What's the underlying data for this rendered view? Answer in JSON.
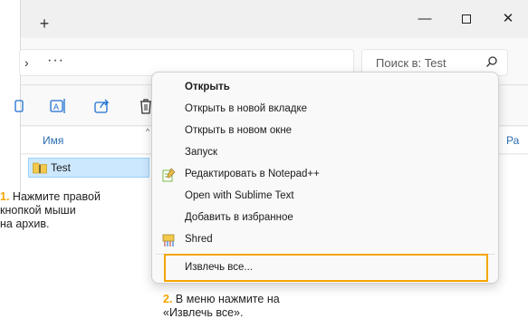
{
  "window": {
    "new_tab": "+",
    "minimize": "—",
    "close": "✕"
  },
  "nav": {
    "chevron": "›",
    "overflow": "···",
    "search_placeholder": "Поиск в: Test"
  },
  "list": {
    "col_name": "Имя",
    "col_right": "Ра",
    "file_name": "Test"
  },
  "menu": {
    "items": [
      {
        "label": "Открыть",
        "icon": ""
      },
      {
        "label": "Открыть в новой вкладке",
        "icon": ""
      },
      {
        "label": "Открыть в новом окне",
        "icon": ""
      },
      {
        "label": "Запуск",
        "icon": ""
      },
      {
        "label": "Редактировать в Notepad++",
        "icon": "notepad-icon"
      },
      {
        "label": "Open with Sublime Text",
        "icon": ""
      },
      {
        "label": "Добавить в избранное",
        "icon": ""
      },
      {
        "label": "Shred",
        "icon": "shred-icon"
      },
      {
        "label": "Извлечь все...",
        "icon": ""
      }
    ]
  },
  "annotations": {
    "step1_num": "1.",
    "step1_text": [
      " Нажмите правой",
      "кнопкой мыши",
      "на архив."
    ],
    "step2_num": "2.",
    "step2_text": [
      " В меню нажмите на",
      "«Извлечь все»."
    ]
  },
  "colors": {
    "accent": "#f5a500",
    "selection": "#cce8ff"
  }
}
